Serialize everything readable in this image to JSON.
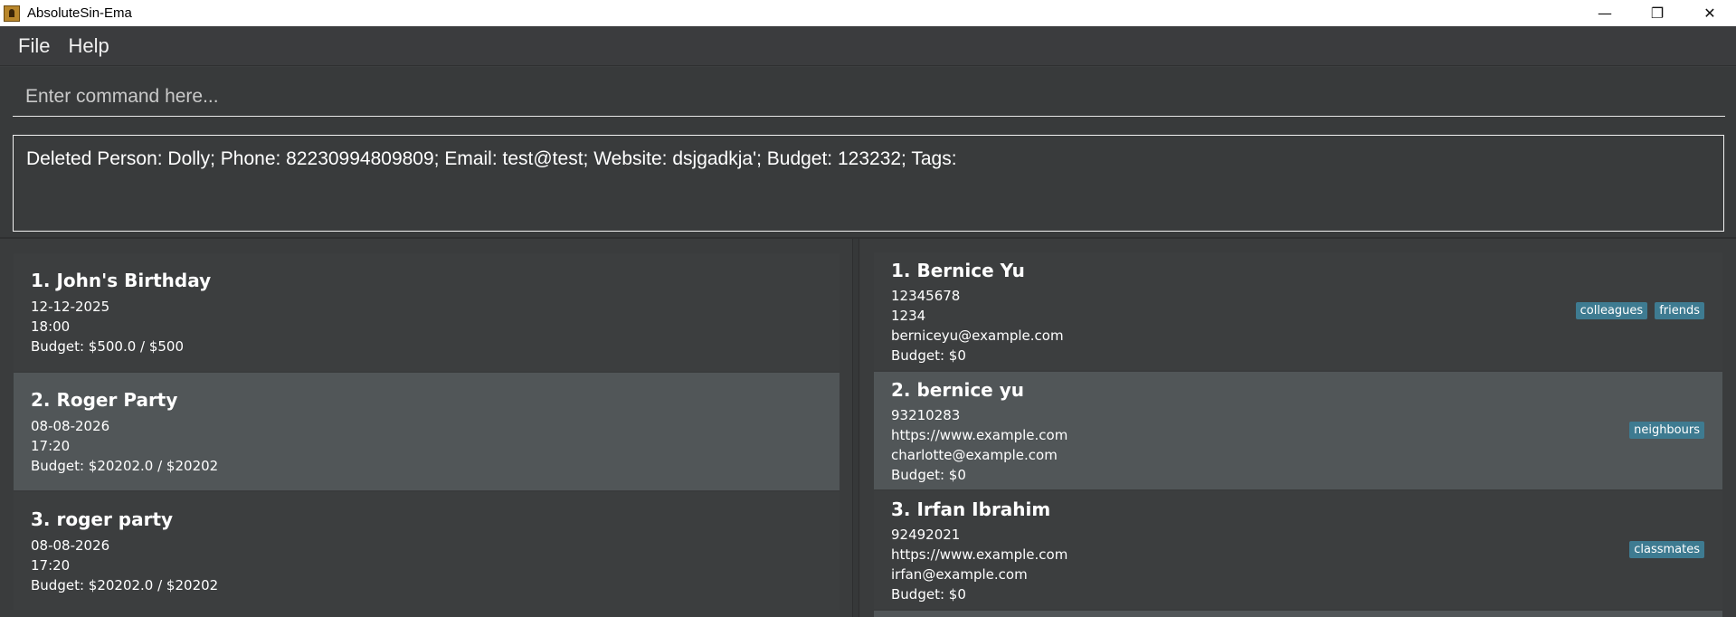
{
  "window": {
    "title": "AbsoluteSin-Ema",
    "minimize": "—",
    "restore": "❐",
    "close": "✕"
  },
  "menu": {
    "file": "File",
    "help": "Help"
  },
  "command": {
    "placeholder": "Enter command here...",
    "value": ""
  },
  "result": {
    "text": "Deleted Person: Dolly; Phone: 82230994809809; Email: test@test; Website: dsjgadkja'; Budget: 123232; Tags:"
  },
  "events": [
    {
      "name": "1. John's Birthday",
      "date": "12-12-2025",
      "time": "18:00",
      "budget": "Budget: $500.0 / $500"
    },
    {
      "name": "2. Roger Party",
      "date": "08-08-2026",
      "time": "17:20",
      "budget": "Budget: $20202.0 / $20202"
    },
    {
      "name": "3. roger party",
      "date": "08-08-2026",
      "time": "17:20",
      "budget": "Budget: $20202.0 / $20202"
    }
  ],
  "persons": [
    {
      "name": "1. Bernice Yu",
      "phone": "12345678",
      "website": "1234",
      "email": "berniceyu@example.com",
      "budget": "Budget: $0",
      "tags": [
        "colleagues",
        "friends"
      ]
    },
    {
      "name": "2. bernice yu",
      "phone": "93210283",
      "website": "https://www.example.com",
      "email": "charlotte@example.com",
      "budget": "Budget: $0",
      "tags": [
        "neighbours"
      ]
    },
    {
      "name": "3. Irfan Ibrahim",
      "phone": "92492021",
      "website": "https://www.example.com",
      "email": "irfan@example.com",
      "budget": "Budget: $0",
      "tags": [
        "classmates"
      ]
    }
  ],
  "colors": {
    "background": "#3c3e3f",
    "selected_card": "#515658",
    "tag": "#3e7b91"
  }
}
